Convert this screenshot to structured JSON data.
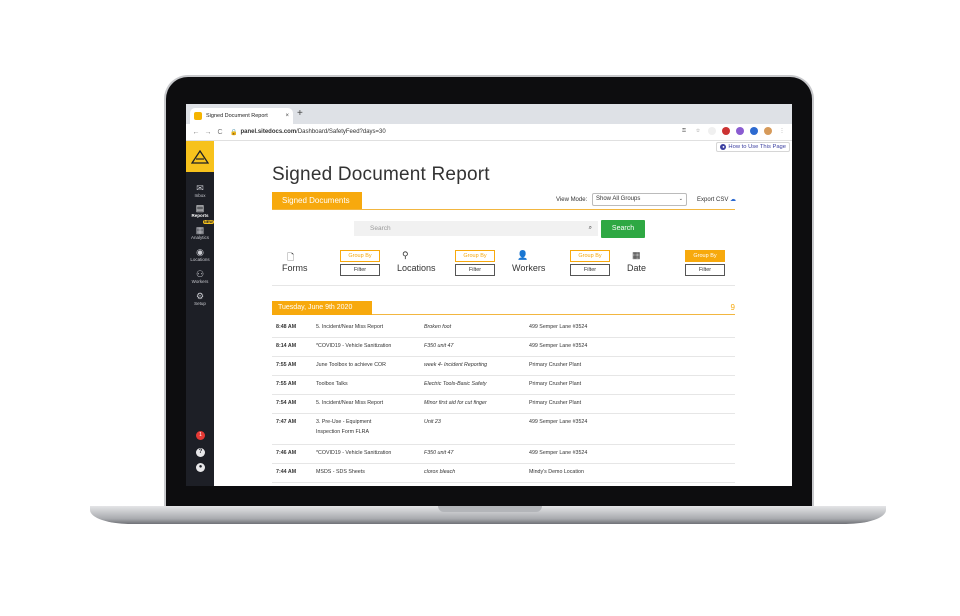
{
  "browser": {
    "tab_title": "Signed Document Report",
    "tab_close": "×",
    "new_tab": "+",
    "url_domain": "panel.sitedocs.com",
    "url_path": "/Dashboard/SafetyFeed?days=30"
  },
  "sidebar": {
    "items": [
      {
        "label": "Inbox",
        "icon": "inbox-icon"
      },
      {
        "label": "Reports",
        "icon": "clipboard-icon"
      },
      {
        "label": "Analytics",
        "icon": "analytics-icon"
      },
      {
        "label": "Locations",
        "icon": "map-pin-icon"
      },
      {
        "label": "Workers",
        "icon": "people-icon"
      },
      {
        "label": "Setup",
        "icon": "gear-icon"
      }
    ],
    "new_badge": "NEW",
    "notification_count": "1"
  },
  "header": {
    "help_link": "How to Use This Page",
    "page_title": "Signed Document Report",
    "section_tab": "Signed Documents",
    "view_mode_label": "View Mode:",
    "view_mode_value": "Show All Groups",
    "export_label": "Export CSV"
  },
  "search": {
    "placeholder": "Search",
    "button": "Search"
  },
  "filters": [
    {
      "label": "Forms",
      "icon": "document-icon",
      "group_by": "Group By",
      "filter": "Filter"
    },
    {
      "label": "Locations",
      "icon": "map-pin-icon",
      "group_by": "Group By",
      "filter": "Filter"
    },
    {
      "label": "Workers",
      "icon": "person-icon",
      "group_by": "Group By",
      "filter": "Filter"
    },
    {
      "label": "Date",
      "icon": "calendar-icon",
      "group_by": "Group By",
      "filter": "Filter"
    }
  ],
  "date_group": {
    "label": "Tuesday, June 9th 2020",
    "count": "9"
  },
  "rows": [
    {
      "time": "8:48 AM",
      "form": "5. Incident/Near Miss Report",
      "note": "Broken foot",
      "location": "499 Semper Lane #3524"
    },
    {
      "time": "8:14 AM",
      "form": "*COVID19 - Vehicle Sanitization",
      "note": "F350 unit 47",
      "location": "499 Semper Lane #3524"
    },
    {
      "time": "7:55 AM",
      "form": "June Toolbox to achieve COR",
      "note": "week 4- Incident Reporting",
      "location": "Primary Crusher Plant"
    },
    {
      "time": "7:55 AM",
      "form": "Toolbox Talks",
      "note": "Electric Tools-Basic Safety",
      "location": "Primary Crusher Plant"
    },
    {
      "time": "7:54 AM",
      "form": "5. Incident/Near Miss Report",
      "note": "Minor first aid for cut finger",
      "location": "Primary Crusher Plant"
    },
    {
      "time": "7:47 AM",
      "form": "3. Pre-Use - Equipment Inspection Form FLRA",
      "note": "Unit 23",
      "location": "499 Semper Lane #3524"
    },
    {
      "time": "7:46 AM",
      "form": "*COVID19 - Vehicle Sanitization",
      "note": "F350 unit 47",
      "location": "499 Semper Lane #3524"
    },
    {
      "time": "7:44 AM",
      "form": "MSDS - SDS Sheets",
      "note": "clorox bleach",
      "location": "Mindy's Demo Location"
    }
  ]
}
